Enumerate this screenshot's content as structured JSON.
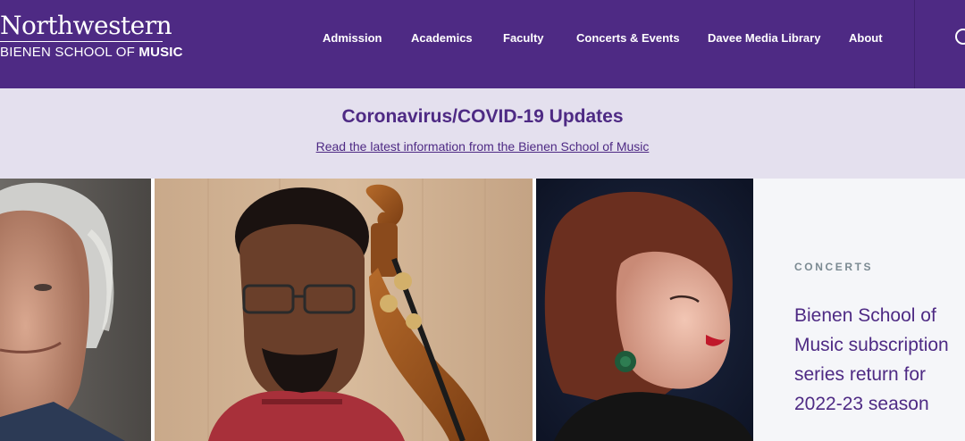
{
  "header": {
    "logo_top": "Northwestern",
    "logo_bottom_regular": "BIENEN SCHOOL OF ",
    "logo_bottom_bold": "MUSIC",
    "nav": [
      "Admission",
      "Academics",
      "Faculty",
      "Concerts & Events",
      "Davee Media Library",
      "About"
    ],
    "search_icon": "search-icon"
  },
  "alert": {
    "title": "Coronavirus/COVID-19 Updates",
    "link": "Read the latest information from the Bienen School of Music"
  },
  "hero": {
    "eyebrow": "CONCERTS",
    "title_lines": [
      "Bienen School of",
      "Music subscription",
      "series return for",
      "2022-23 season"
    ]
  },
  "colors": {
    "brand_purple": "#4e2a84",
    "alert_bg": "#e4e0ee",
    "story_bg": "#f5f6f9",
    "eyebrow": "#7b8a92"
  }
}
